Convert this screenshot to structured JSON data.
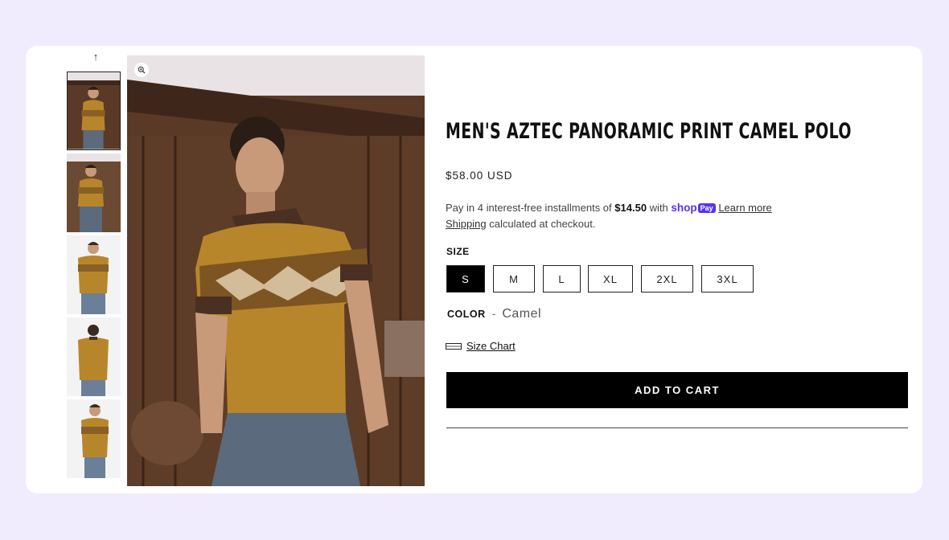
{
  "gallery": {
    "up_arrow": "↑",
    "zoom_icon": "zoom-in-icon",
    "colors": {
      "shirt": "#b8862a",
      "collar": "#4a3022",
      "wood": "#5a3a26",
      "sky": "#e9e3e6",
      "jeans": "#5b6a7d"
    }
  },
  "product": {
    "title": "MEN'S AZTEC PANORAMIC PRINT CAMEL POLO",
    "price": "$58.00 USD",
    "installments_prefix": "Pay in 4 interest-free installments of",
    "installment_amount": "$14.50",
    "installments_with": "with",
    "shop_brand": "shop",
    "pay_badge": "Pay",
    "learn_more": "Learn more",
    "shipping_link": "Shipping",
    "shipping_suffix": "calculated at checkout.",
    "size_label": "SIZE",
    "sizes": [
      "S",
      "M",
      "L",
      "XL",
      "2XL",
      "3XL"
    ],
    "selected_size": "S",
    "color_label": "COLOR",
    "color_sep": "-",
    "color_value": "Camel",
    "size_chart": "Size Chart",
    "add_to_cart": "ADD TO CART"
  },
  "accent": "#000000",
  "shoppay_color": "#5a31f4"
}
